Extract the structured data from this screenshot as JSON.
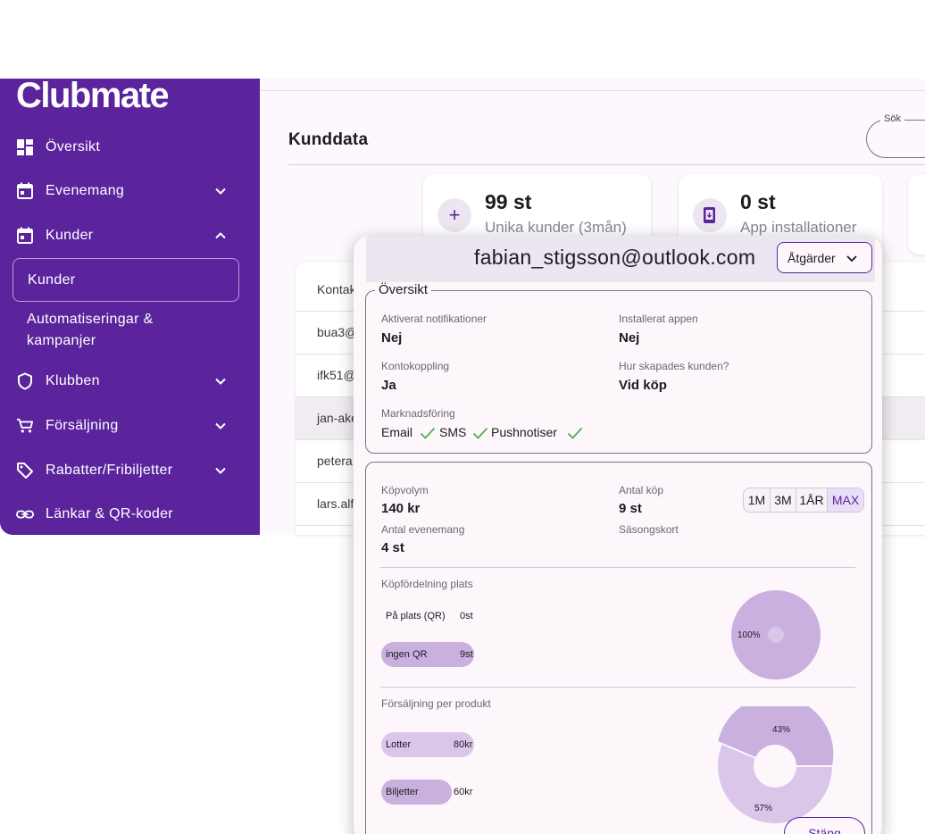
{
  "brand": {
    "logo": "Clubmate",
    "primary": "#5b249d",
    "accent_light": "#e8def8"
  },
  "sidebar": {
    "items": [
      {
        "label": "Översikt",
        "icon": "dashboard-icon"
      },
      {
        "label": "Evenemang",
        "icon": "calendar-icon",
        "chevron": "down"
      },
      {
        "label": "Kunder",
        "icon": "calendar-icon",
        "chevron": "up"
      },
      {
        "label": "Klubben",
        "icon": "shield-icon",
        "chevron": "down"
      },
      {
        "label": "Försäljning",
        "icon": "cart-icon",
        "chevron": "down"
      },
      {
        "label": "Rabatter/Fribiljetter",
        "icon": "tag-icon",
        "chevron": "down"
      },
      {
        "label": "Länkar & QR-koder",
        "icon": "link-icon"
      }
    ],
    "sub": {
      "active": "Kunder",
      "second": "Automatiseringar & kampanjer"
    }
  },
  "main": {
    "title": "Kunddata",
    "search_label": "Sök",
    "stats": [
      {
        "value": "99 st",
        "caption": "Unika kunder (3mån)",
        "icon": "plus-icon"
      },
      {
        "value": "0 st",
        "caption": "App installationer",
        "icon": "app-install-icon"
      }
    ],
    "table": {
      "header": "Kontak",
      "rows": [
        "bua3@",
        "ifk51@",
        "jan-ake",
        "petera",
        "lars.alf"
      ]
    }
  },
  "modal": {
    "email": "fabian_stigsson@outlook.com",
    "actions_label": "Åtgärder",
    "overview": {
      "title": "Översikt",
      "fields": [
        {
          "label": "Aktiverat notifikationer",
          "value": "Nej"
        },
        {
          "label": "Installerat appen",
          "value": "Nej"
        },
        {
          "label": "Kontokoppling",
          "value": "Ja"
        },
        {
          "label": "Hur skapades kunden?",
          "value": "Vid köp"
        }
      ],
      "marketing_label": "Marknadsföring",
      "marketing": [
        "Email",
        "SMS",
        "Pushnotiser"
      ]
    },
    "purchases": {
      "fields": [
        {
          "label": "Köpvolym",
          "value": "140 kr"
        },
        {
          "label": "Antal köp",
          "value": "9 st"
        },
        {
          "label": "Antal evenemang",
          "value": "4 st"
        },
        {
          "label": "Säsongskort",
          "value": ""
        }
      ],
      "periods": [
        "1M",
        "3M",
        "1ÅR",
        "MAX"
      ],
      "selected_period": "MAX"
    },
    "place_distribution": {
      "title": "Köpfördelning plats",
      "items": [
        {
          "name": "På plats (QR)",
          "value_label": "0st",
          "value": 0
        },
        {
          "name": "ingen QR",
          "value_label": "9st",
          "value": 9
        }
      ],
      "pie_label": "100%"
    },
    "product_sales": {
      "title": "Försäljning per produkt",
      "items": [
        {
          "name": "Lotter",
          "value_label": "80kr",
          "value": 80
        },
        {
          "name": "Biljetter",
          "value_label": "60kr",
          "value": 60
        }
      ],
      "pie_labels": [
        "43%",
        "57%"
      ]
    },
    "close_label": "Stäng"
  }
}
